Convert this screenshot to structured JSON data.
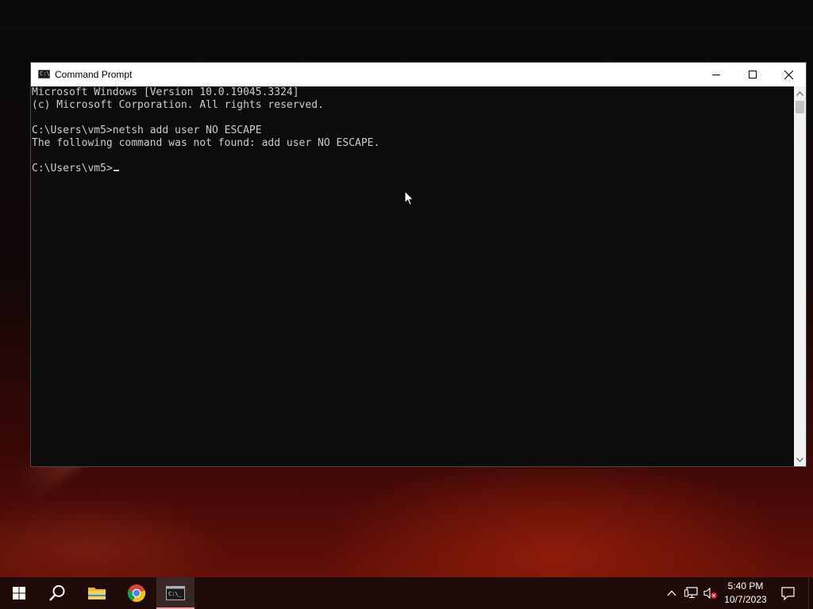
{
  "window": {
    "title": "Command Prompt"
  },
  "console": {
    "lines": [
      "Microsoft Windows [Version 10.0.19045.3324]",
      "(c) Microsoft Corporation. All rights reserved.",
      "",
      "C:\\Users\\vm5>netsh add user NO ESCAPE",
      "The following command was not found: add user NO ESCAPE.",
      "",
      "C:\\Users\\vm5>"
    ]
  },
  "taskbar": {
    "items": [
      {
        "name": "start",
        "icon": "windows-logo-icon"
      },
      {
        "name": "search",
        "icon": "search-icon"
      },
      {
        "name": "file-explorer",
        "icon": "folder-icon"
      },
      {
        "name": "chrome",
        "icon": "chrome-icon"
      },
      {
        "name": "command-prompt",
        "icon": "cmd-icon",
        "active": true
      }
    ],
    "clock": {
      "time": "5:40 PM",
      "date": "10/7/2023"
    }
  },
  "colors": {
    "console_bg": "#0c0c0c",
    "console_text": "#cccccc",
    "titlebar_bg": "#ffffff",
    "taskbar_bg": "#1f0b09"
  }
}
